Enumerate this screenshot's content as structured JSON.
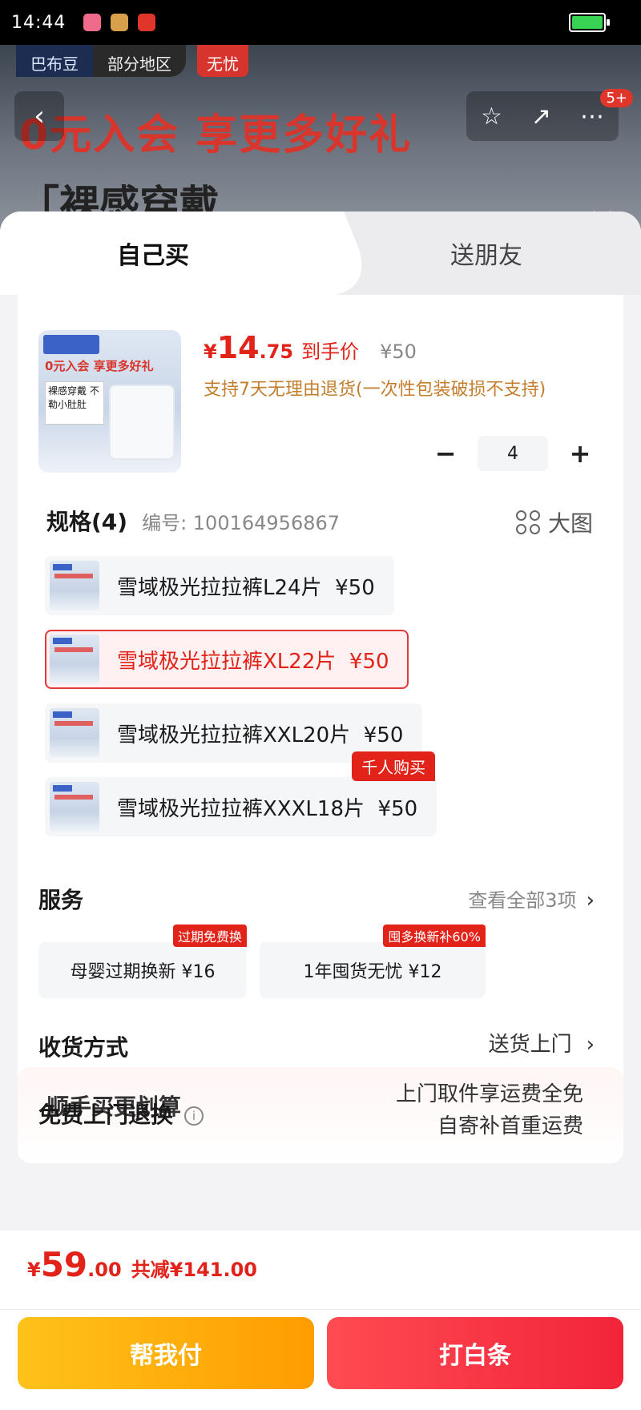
{
  "status_bar": {
    "time": "14:44"
  },
  "background": {
    "badge_brand": "巴布豆",
    "badge_region": "部分地区",
    "badge_worry": "无忧",
    "promo_title": "0元入会 享更多好礼",
    "promo_sub": "「裸感穿戴",
    "notification_count": "5+"
  },
  "tabs": {
    "self": "自己买",
    "friend": "送朋友"
  },
  "product": {
    "currency": "¥",
    "price_int": "14",
    "price_dec": ".75",
    "price_tag": "到手价",
    "original_price": "¥50",
    "return_policy": "支持7天无理由退货(一次性包装破损不支持)",
    "quantity": "4",
    "thumb_text": "0元入会 享更多好礼",
    "thumb_box_text": "裸感穿戴 不勒小肚肚"
  },
  "spec": {
    "title": "规格(4)",
    "code": "编号: 100164956867",
    "big_image": "大图",
    "options": [
      {
        "label": "雪域极光拉拉裤L24片",
        "price": "¥50",
        "selected": false,
        "tag": ""
      },
      {
        "label": "雪域极光拉拉裤XL22片",
        "price": "¥50",
        "selected": true,
        "tag": ""
      },
      {
        "label": "雪域极光拉拉裤XXL20片",
        "price": "¥50",
        "selected": false,
        "tag": ""
      },
      {
        "label": "雪域极光拉拉裤XXXL18片",
        "price": "¥50",
        "selected": false,
        "tag": "千人购买"
      }
    ]
  },
  "services": {
    "title": "服务",
    "view_all": "查看全部3项",
    "items": [
      {
        "label": "母婴过期换新 ¥16",
        "tag": "过期免费换"
      },
      {
        "label": "1年囤货无忧 ¥12",
        "tag": "囤多换新补60%"
      }
    ]
  },
  "delivery": {
    "label": "收货方式",
    "value": "送货上门"
  },
  "returns": {
    "label": "免费上门退换",
    "line1": "上门取件享运费全免",
    "line2": "自寄补首重运费"
  },
  "peek": {
    "text": "顺手买更划算"
  },
  "bottom": {
    "currency": "¥",
    "total_int": "59",
    "total_dec": ".00",
    "discount": "共减¥141.00",
    "pay_button": "帮我付",
    "credit_button": "打白条"
  },
  "colors": {
    "accent": "#e2231a",
    "pay": "#ffb000",
    "credit": "#f2243a",
    "policy": "#c47e2e"
  }
}
